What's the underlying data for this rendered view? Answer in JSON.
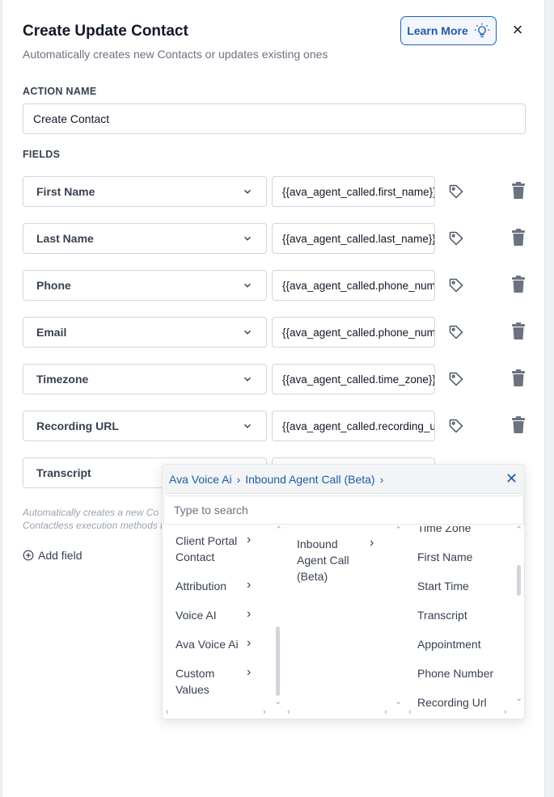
{
  "header": {
    "title": "Create Update Contact",
    "subtitle": "Automatically creates new Contacts or updates existing ones",
    "learn_more": "Learn More",
    "close": "×"
  },
  "action_name": {
    "label": "ACTION NAME",
    "value": "Create Contact"
  },
  "fields": {
    "label": "FIELDS",
    "rows": [
      {
        "field": "First Name",
        "value": "{{ava_agent_called.first_name}}"
      },
      {
        "field": "Last Name",
        "value": "{{ava_agent_called.last_name}}"
      },
      {
        "field": "Phone",
        "value": "{{ava_agent_called.phone_number}}"
      },
      {
        "field": "Email",
        "value": "{{ava_agent_called.phone_number}}"
      },
      {
        "field": "Timezone",
        "value": "{{ava_agent_called.time_zone}}"
      },
      {
        "field": "Recording URL",
        "value": "{{ava_agent_called.recording_url}}"
      },
      {
        "field": "Transcript",
        "value": ""
      }
    ]
  },
  "help_text": {
    "line1": "Automatically creates a new Co",
    "line2": "Contactless execution methods b"
  },
  "add_field": "Add field",
  "picker": {
    "breadcrumb": [
      "Ava Voice Ai",
      "Inbound Agent Call (Beta)"
    ],
    "search_placeholder": "Type to search",
    "col1": [
      "Client Portal Contact",
      "Attribution",
      "Voice AI",
      "Ava Voice Ai",
      "Custom Values"
    ],
    "col2": [
      "Inbound Agent Call (Beta)"
    ],
    "col3": [
      "Time Zone",
      "First Name",
      "Start Time",
      "Transcript",
      "Appointment",
      "Phone Number",
      "Recording Url"
    ]
  },
  "colors": {
    "accent": "#1e5aa8",
    "border": "#d1d5db",
    "trash": "#6b7280"
  }
}
